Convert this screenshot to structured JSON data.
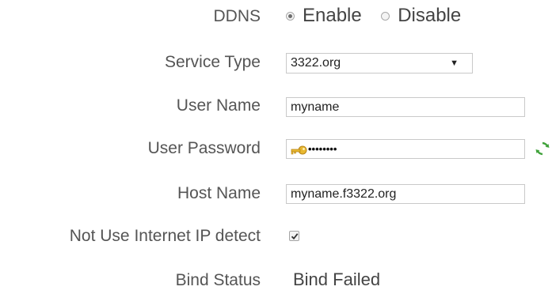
{
  "ddns": {
    "label": "DDNS",
    "options": [
      {
        "label": "Enable",
        "checked": true
      },
      {
        "label": "Disable",
        "checked": false
      }
    ]
  },
  "service_type": {
    "label": "Service Type",
    "selected": "3322.org"
  },
  "user_name": {
    "label": "User Name",
    "value": "myname"
  },
  "user_password": {
    "label": "User Password",
    "masked_value": "••••••••",
    "key_icon": "key-icon",
    "refresh_icon": "refresh-icon"
  },
  "host_name": {
    "label": "Host Name",
    "value": "myname.f3322.org"
  },
  "ip_detect": {
    "label": "Not Use Internet IP detect",
    "checked": true
  },
  "bind_status": {
    "label": "Bind Status",
    "value": "Bind Failed"
  }
}
